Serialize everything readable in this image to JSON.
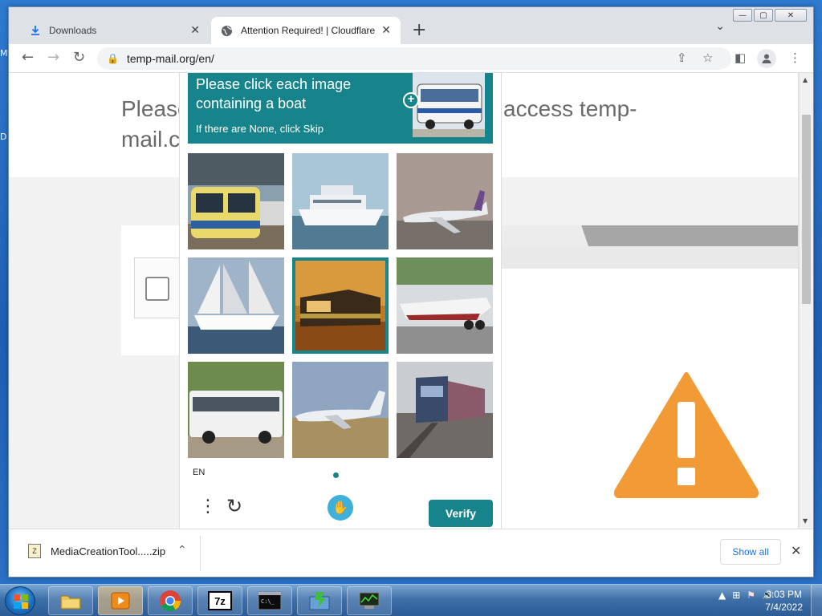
{
  "desktop": {
    "left_texts": [
      "M",
      "D"
    ]
  },
  "window": {
    "controls": {
      "minimize": "—",
      "maximize": "▢",
      "close": "✕"
    }
  },
  "tabs": [
    {
      "label": "Downloads",
      "icon": "download-icon",
      "close": "✕"
    },
    {
      "label": "Attention Required! | Cloudflare",
      "icon": "globe-icon",
      "close": "✕"
    }
  ],
  "newtab_label": "+",
  "toolbar": {
    "back": "←",
    "forward": "→",
    "reload": "↻",
    "url": "temp-mail.org/en/",
    "share": "⇪",
    "bookmark": "☆",
    "sidepanel": "◧",
    "menu": "⋮"
  },
  "page": {
    "heading_left_line1": "Please",
    "heading_left_line2": "mail.c",
    "heading_right": "access temp-",
    "warning_glyph": "!"
  },
  "captcha": {
    "prompt": "Please click each image containing a boat",
    "skip_hint": "If there are None, click Skip",
    "plus": "+",
    "tiles": [
      {
        "subject": "train",
        "selected": false
      },
      {
        "subject": "boat",
        "selected": false
      },
      {
        "subject": "airplane",
        "selected": false
      },
      {
        "subject": "boat",
        "selected": false
      },
      {
        "subject": "train",
        "selected": true
      },
      {
        "subject": "boat",
        "selected": false
      },
      {
        "subject": "bus",
        "selected": false
      },
      {
        "subject": "airplane",
        "selected": false
      },
      {
        "subject": "train",
        "selected": false
      }
    ],
    "language": "EN",
    "menu_glyph": "⋮",
    "refresh_glyph": "↻",
    "verify_label": "Verify",
    "accent": "#16848a"
  },
  "download_bar": {
    "file_name": "MediaCreationTool.....zip",
    "chevron": "⌃",
    "show_all": "Show all",
    "close": "✕"
  },
  "taskbar": {
    "clock_time": "3:03 PM",
    "clock_date": "7/4/2022",
    "tray_glyphs": [
      "▲",
      "⊞",
      "⚑",
      "🔊"
    ]
  }
}
